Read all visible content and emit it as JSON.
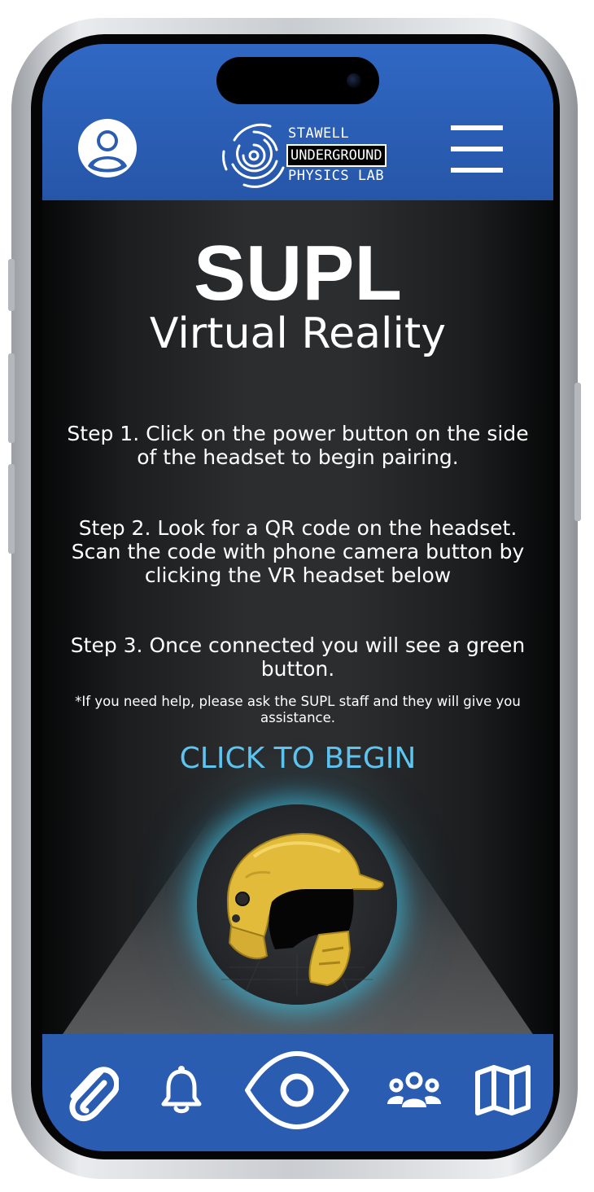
{
  "header": {
    "profile_icon": "user-circle-icon",
    "menu_icon": "hamburger-menu-icon",
    "logo": {
      "line1": "STAWELL",
      "line2": "UNDERGROUND",
      "line3": "PHYSICS LAB"
    }
  },
  "main": {
    "title": "SUPL",
    "subtitle": "Virtual Reality",
    "steps": [
      "Step 1. Click on the power button on the side of the headset to begin pairing.",
      "Step 2. Look for a QR code on the headset. Scan the code with phone camera button by clicking the VR headset below",
      "Step 3. Once connected you will see a green button."
    ],
    "note": "*If you need help, please ask the SUPL staff and they will give you assistance.",
    "cta_label": "CLICK TO BEGIN",
    "headset_image": "vr-helmet-image"
  },
  "bottom_nav": {
    "items": [
      "paperclip-icon",
      "bell-icon",
      "eye-icon",
      "group-icon",
      "map-icon"
    ]
  },
  "colors": {
    "header_blue": "#2a5cb0",
    "cta_blue": "#5ec4f0",
    "glow": "#40c4e6",
    "helmet_yellow": "#e3bd3a"
  }
}
